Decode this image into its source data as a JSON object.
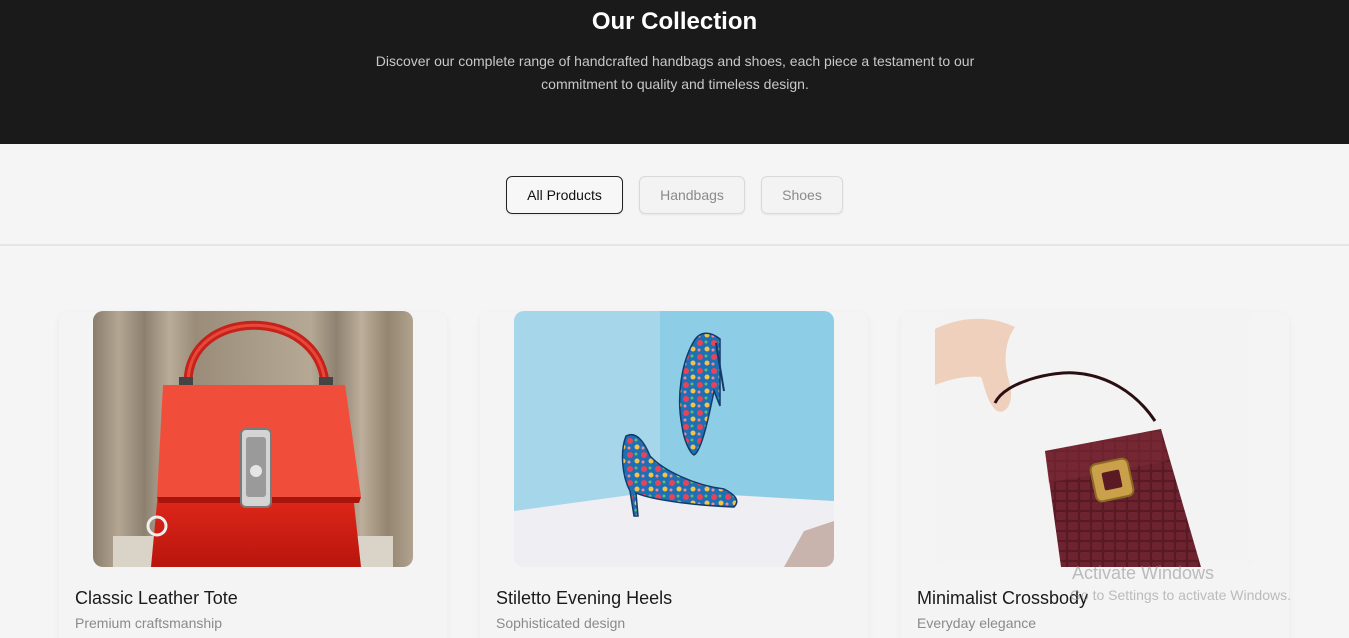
{
  "header": {
    "title": "Our Collection",
    "description": "Discover our complete range of handcrafted handbags and shoes, each piece a testament to our commitment to quality and timeless design."
  },
  "filters": [
    {
      "label": "All Products",
      "active": true
    },
    {
      "label": "Handbags",
      "active": false
    },
    {
      "label": "Shoes",
      "active": false
    }
  ],
  "products": [
    {
      "name": "Classic Leather Tote",
      "tagline": "Premium craftsmanship",
      "image": "red-leather-handbag"
    },
    {
      "name": "Stiletto Evening Heels",
      "tagline": "Sophisticated design",
      "image": "floral-stiletto-heels"
    },
    {
      "name": "Minimalist Crossbody",
      "tagline": "Everyday elegance",
      "image": "burgundy-croc-bag"
    }
  ],
  "watermark": {
    "title": "Activate Windows",
    "subtitle": "Go to Settings to activate Windows."
  },
  "colors": {
    "hero_bg": "#1a1a1a",
    "page_bg": "#f5f5f5",
    "accent": "#111111"
  }
}
